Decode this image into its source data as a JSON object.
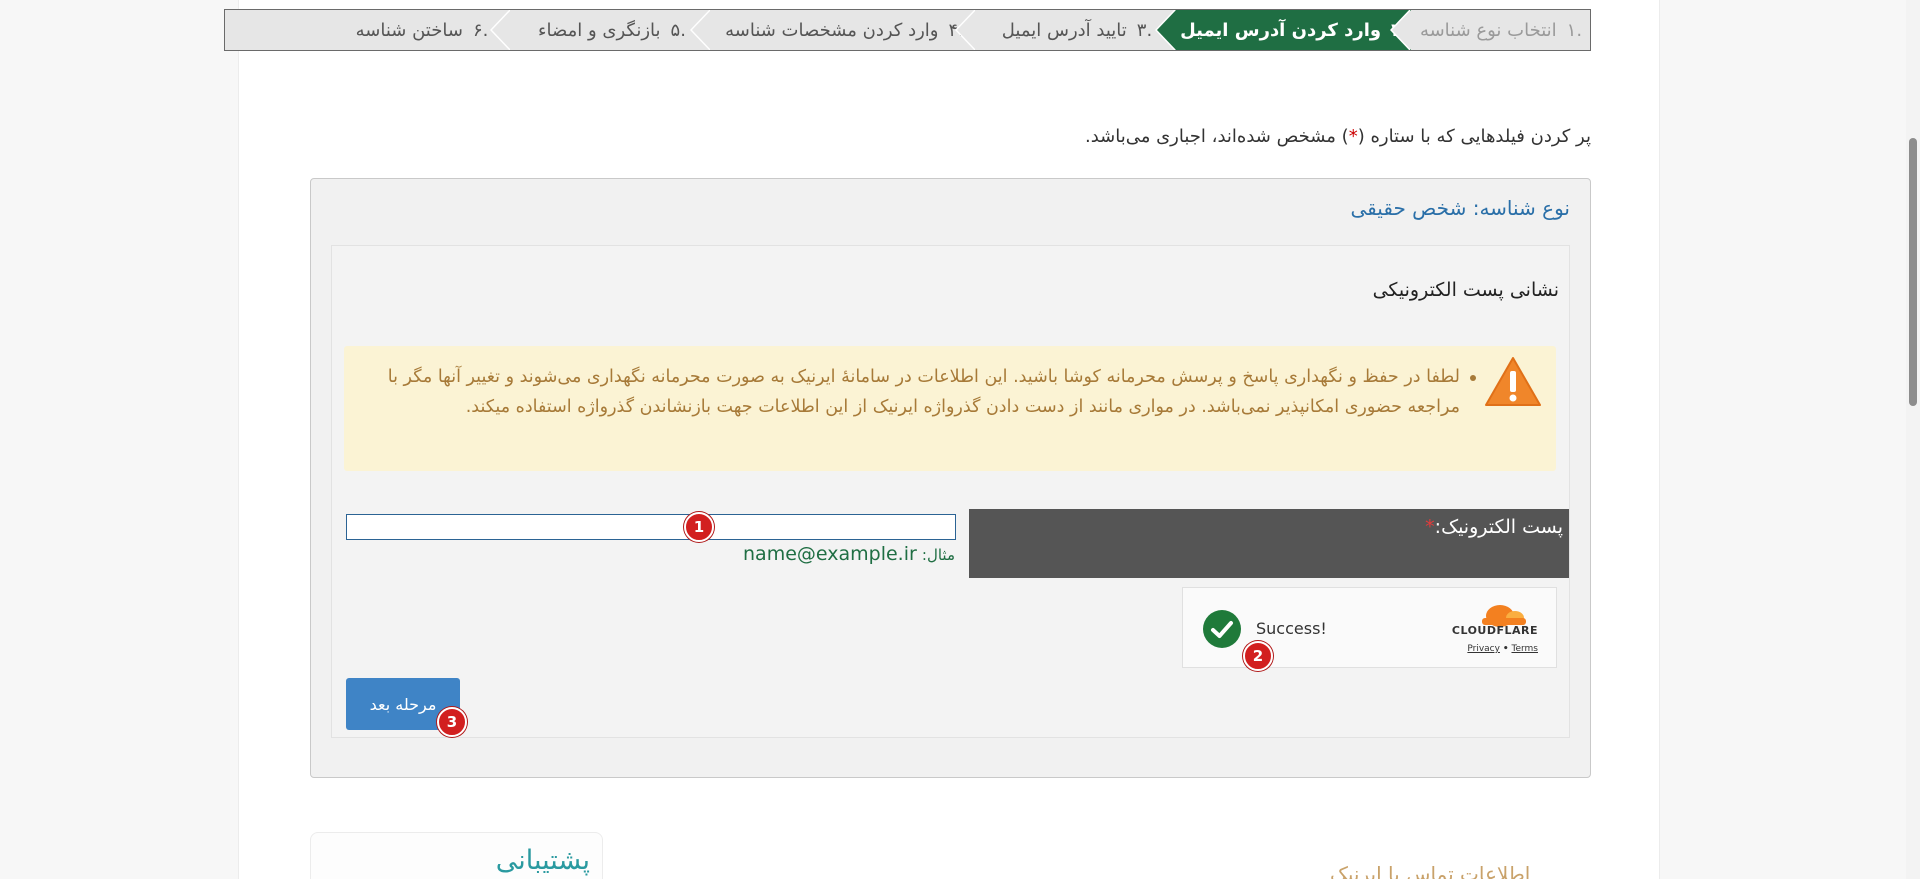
{
  "steps": [
    {
      "num": ".۱",
      "label": "انتخاب نوع شناسه",
      "state": "done"
    },
    {
      "num": ".۲",
      "label": "وارد کردن آدرس ایمیل",
      "state": "active"
    },
    {
      "num": ".۳",
      "label": "تایید آدرس ایمیل",
      "state": "todo"
    },
    {
      "num": ".۴",
      "label": "وارد کردن مشخصات شناسه",
      "state": "todo"
    },
    {
      "num": ".۵",
      "label": "بازنگری و امضاء",
      "state": "todo"
    },
    {
      "num": ".۶",
      "label": "ساختن شناسه",
      "state": "todo"
    }
  ],
  "required_note": {
    "before": "پر کردن فیلدهایی که با ستاره (",
    "star": "*",
    "after": ") مشخص شده‌اند، اجباری می‌باشد."
  },
  "panel": {
    "title": "نوع شناسه: شخص حقیقی",
    "section_label": "نشانی پست الکترونیکی",
    "warning": "لطفا در حفظ و نگهداری پاسخ و پرسش محرمانه کوشا باشید. این اطلاعات در سامانهٔ ایرنیک به صورت محرمانه نگهداری می‌شوند و تغییر آنها مگر با مراجعه حضوری امکانپذیر نمی‌باشد. در مواری مانند از دست دادن گذرواژه ایرنیک از این اطلاعات جهت بازنشاندن گذرواژه استفاده میکند.",
    "email_label": "پست الکترونیک:",
    "email_star": "*",
    "email_value": "",
    "example_label": "مثال:",
    "example_value": "name@example.ir",
    "captcha_status": "Success!",
    "captcha_brand": "CLOUDFLARE",
    "captcha_privacy": "Privacy",
    "captcha_sep": "•",
    "captcha_terms": "Terms",
    "next_button": "مرحله بعد"
  },
  "markers": [
    "1",
    "2",
    "3"
  ],
  "support_title": "پشتیبانی",
  "footer_text": "اطلاعات تماس با ایرنیک",
  "colors": {
    "active_step": "#1f6e43",
    "link_blue": "#2a6fa8",
    "button": "#3f84c6",
    "warning_bg": "#fbf3d4",
    "marker": "#d21f1f"
  }
}
